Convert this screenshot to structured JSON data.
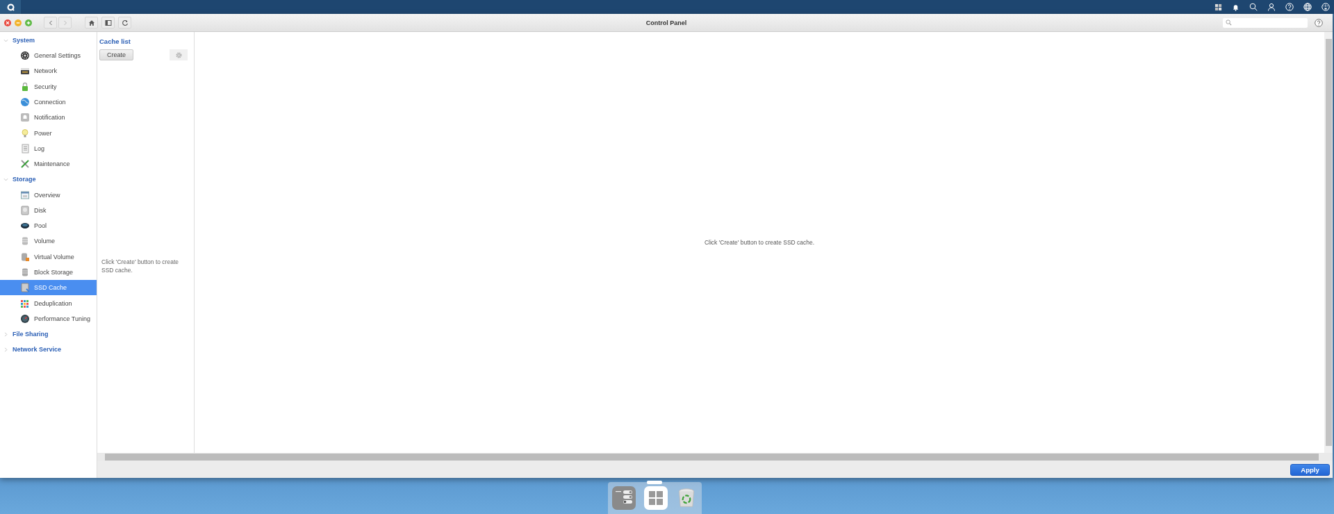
{
  "window": {
    "title": "Control Panel"
  },
  "sidebar": {
    "sections": [
      {
        "label": "System",
        "expanded": true,
        "children": [
          {
            "label": "General Settings",
            "selected": false
          },
          {
            "label": "Network",
            "selected": false
          },
          {
            "label": "Security",
            "selected": false
          },
          {
            "label": "Connection",
            "selected": false
          },
          {
            "label": "Notification",
            "selected": false
          },
          {
            "label": "Power",
            "selected": false
          },
          {
            "label": "Log",
            "selected": false
          },
          {
            "label": "Maintenance",
            "selected": false
          }
        ]
      },
      {
        "label": "Storage",
        "expanded": true,
        "children": [
          {
            "label": "Overview",
            "selected": false
          },
          {
            "label": "Disk",
            "selected": false
          },
          {
            "label": "Pool",
            "selected": false
          },
          {
            "label": "Volume",
            "selected": false
          },
          {
            "label": "Virtual Volume",
            "selected": false
          },
          {
            "label": "Block Storage",
            "selected": false
          },
          {
            "label": "SSD Cache",
            "selected": true
          },
          {
            "label": "Deduplication",
            "selected": false
          },
          {
            "label": "Performance Tuning",
            "selected": false
          }
        ]
      },
      {
        "label": "File Sharing",
        "expanded": false
      },
      {
        "label": "Network Service",
        "expanded": false
      }
    ]
  },
  "cache_list": {
    "title": "Cache list",
    "create_button": "Create",
    "empty_message": "Click 'Create' button to create SSD cache."
  },
  "main": {
    "empty_message": "Click 'Create' button to create SSD cache."
  },
  "footer": {
    "apply_button": "Apply"
  }
}
